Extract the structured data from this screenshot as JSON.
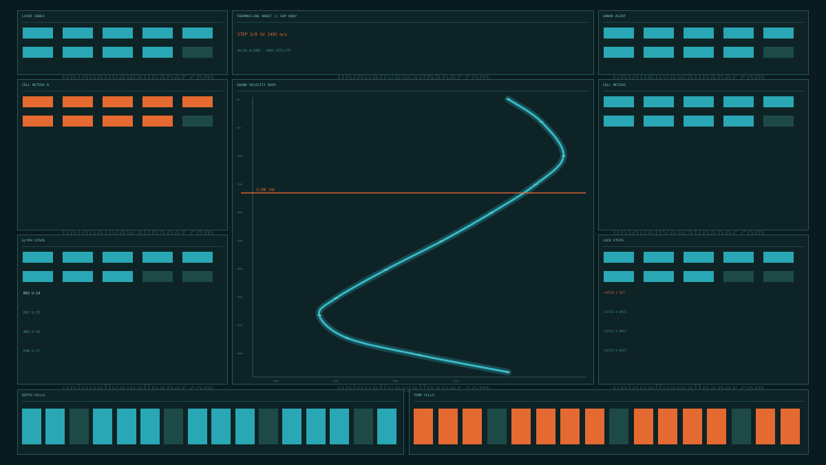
{
  "panels": {
    "layer_index": {
      "title": "LAYER INDEX"
    },
    "thermocline_orbit": {
      "title": "THERMOCLINE ORBIT  //  SVP BODY",
      "step": "STEP 3/8  SV 1492 m/s",
      "sub": "HALIDE ALIGNED · INDEX SATELLITE"
    },
    "sonar_alert": {
      "title": "SONAR ALERT"
    },
    "cell_meters_n": {
      "title": "CELL METERS N"
    },
    "sound_velocity": {
      "title": "SOUND VELOCITY BODY",
      "cline_label": "CLINE 34m"
    },
    "cell_meters": {
      "title": "CELL METERS"
    },
    "glyph_stack": {
      "title": "GLYPH STACK",
      "items": [
        "MIX U-14",
        "DUC U-15",
        "ABS U-16",
        "PHD U-17"
      ]
    },
    "lock_steps": {
      "title": "LOCK STEPS",
      "items": [
        "LATCH 3 SET",
        "LATCH 4 WAIT",
        "LATCH 5 WAIT",
        "LATCH 6 WAIT"
      ]
    },
    "depth_cells": {
      "title": "DEPTH CELLS"
    },
    "temp_cells": {
      "title": "TEMP CELLS"
    }
  },
  "grids": {
    "layer_index": [
      "teal",
      "teal",
      "teal",
      "teal",
      "teal",
      "teal",
      "teal",
      "teal",
      "teal",
      "dim"
    ],
    "sonar_alert": [
      "teal",
      "teal",
      "teal",
      "teal",
      "teal",
      "teal",
      "teal",
      "teal",
      "teal",
      "dim"
    ],
    "cell_meters_n": [
      "orange",
      "orange",
      "orange",
      "orange",
      "orange",
      "orange",
      "orange",
      "orange",
      "orange",
      "dim"
    ],
    "cell_meters": [
      "teal",
      "teal",
      "teal",
      "teal",
      "teal",
      "teal",
      "teal",
      "teal",
      "teal",
      "dim"
    ],
    "glyph_stack": [
      "teal",
      "teal",
      "teal",
      "teal",
      "teal",
      "teal",
      "teal",
      "teal",
      "dim",
      "dim"
    ],
    "lock_steps": [
      "teal",
      "teal",
      "teal",
      "teal",
      "teal",
      "teal",
      "teal",
      "teal",
      "dim",
      "dim"
    ],
    "depth_cells": [
      "teal",
      "teal",
      "dim",
      "teal",
      "teal",
      "teal",
      "dim",
      "teal",
      "teal",
      "teal",
      "dim",
      "teal",
      "teal",
      "teal",
      "dim",
      "teal"
    ],
    "temp_cells": [
      "orange",
      "orange",
      "orange",
      "dim",
      "orange",
      "orange",
      "orange",
      "orange",
      "dim",
      "orange",
      "orange",
      "orange",
      "orange",
      "dim",
      "orange",
      "orange"
    ]
  },
  "colors": {
    "teal": "#2aa7b4",
    "orange": "#e56a31",
    "dim": "#1d4a47",
    "background": "#0a1b1f"
  },
  "watermark": "uniquelivewallpaper.com",
  "chart_data": {
    "type": "line",
    "title": "SOUND VELOCITY BODY",
    "y_ticks": [
      "0m",
      "50m",
      "100m",
      "150m",
      "200m",
      "250m",
      "300m",
      "350m",
      "400m",
      "450m"
    ],
    "x_ticks": [
      "1480",
      "1490",
      "1500",
      "1510"
    ],
    "cline_depth_m": 165,
    "series": [
      {
        "values_x": [
          1506,
          1512,
          1516,
          1511,
          1503,
          1494,
          1484,
          1475,
          1472,
          1477,
          1490,
          1506
        ],
        "values_y": [
          0,
          40,
          100,
          150,
          200,
          250,
          300,
          350,
          380,
          420,
          450,
          480
        ]
      }
    ]
  }
}
